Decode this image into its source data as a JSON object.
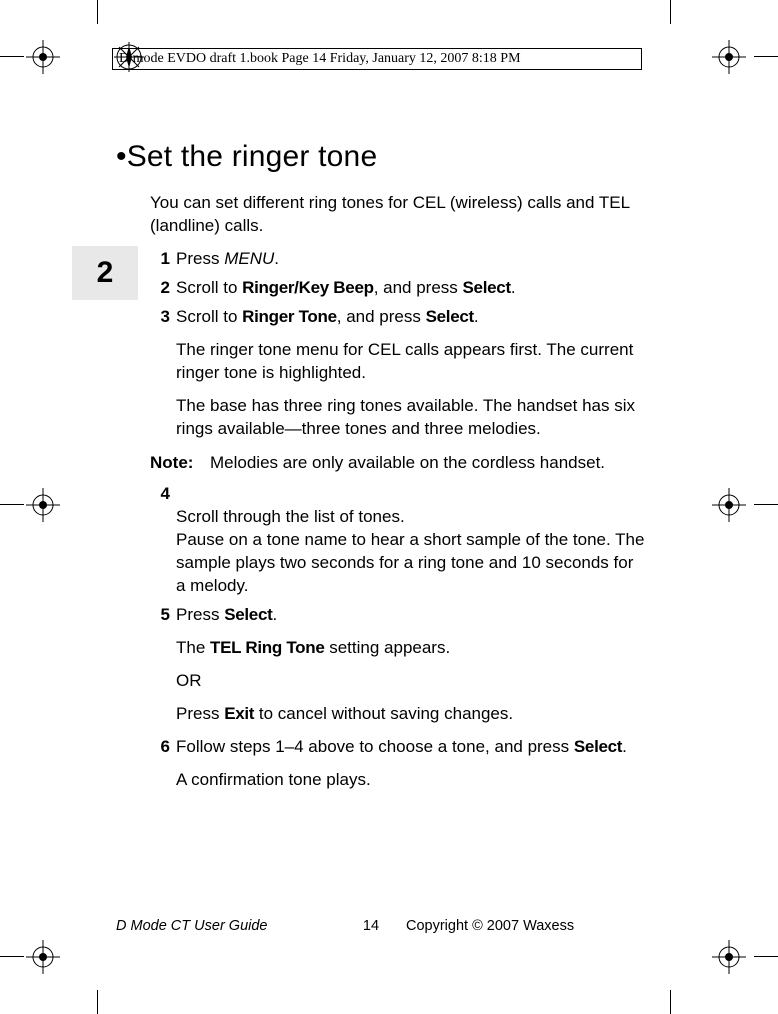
{
  "header": {
    "running_head": "D mode EVDO draft 1.book  Page 14  Friday, January 12, 2007  8:18 PM"
  },
  "chapter_number": "2",
  "heading": "•Set the ringer tone",
  "intro": "You can set different ring tones for CEL (wireless) calls and TEL (landline) calls.",
  "steps": [
    {
      "num": "1",
      "pre": "Press ",
      "key1": "MENU",
      "post": "."
    },
    {
      "num": "2",
      "pre": "Scroll to ",
      "key1": "Ringer/Key Beep",
      "mid": ", and press ",
      "key2": "Select",
      "post": "."
    },
    {
      "num": "3",
      "pre": "Scroll to ",
      "key1": "Ringer Tone",
      "mid": ", and press ",
      "key2": "Select",
      "post": ".",
      "subs": [
        "The ringer tone menu for CEL calls appears first. The current ringer tone is highlighted.",
        "The base has three ring tones available. The handset has six rings available—three tones and three melodies."
      ]
    }
  ],
  "note": {
    "label": "Note:",
    "body": "Melodies are only available on the cordless handset."
  },
  "steps2": [
    {
      "num": "4",
      "text": "Scroll through the list of tones.\nPause on a tone name to hear a short sample of the tone. The sample plays two seconds for a ring tone and 10 seconds for a melody."
    },
    {
      "num": "5",
      "pre": "Press ",
      "key1": "Select",
      "post": ".",
      "subs_rich": {
        "line1_pre": "The ",
        "line1_key": "TEL Ring Tone",
        "line1_post": " setting appears.",
        "line2": "OR",
        "line3_pre": "Press ",
        "line3_key": "Exit",
        "line3_post": " to cancel without saving changes."
      }
    },
    {
      "num": "6",
      "pre": "Follow steps 1–4 above to choose a tone, and press ",
      "key1": "Select",
      "post": ".",
      "subs": [
        "A confirmation tone plays."
      ]
    }
  ],
  "footer": {
    "left": "D Mode CT User Guide",
    "center": "14",
    "right": "Copyright © 2007 Waxess"
  }
}
